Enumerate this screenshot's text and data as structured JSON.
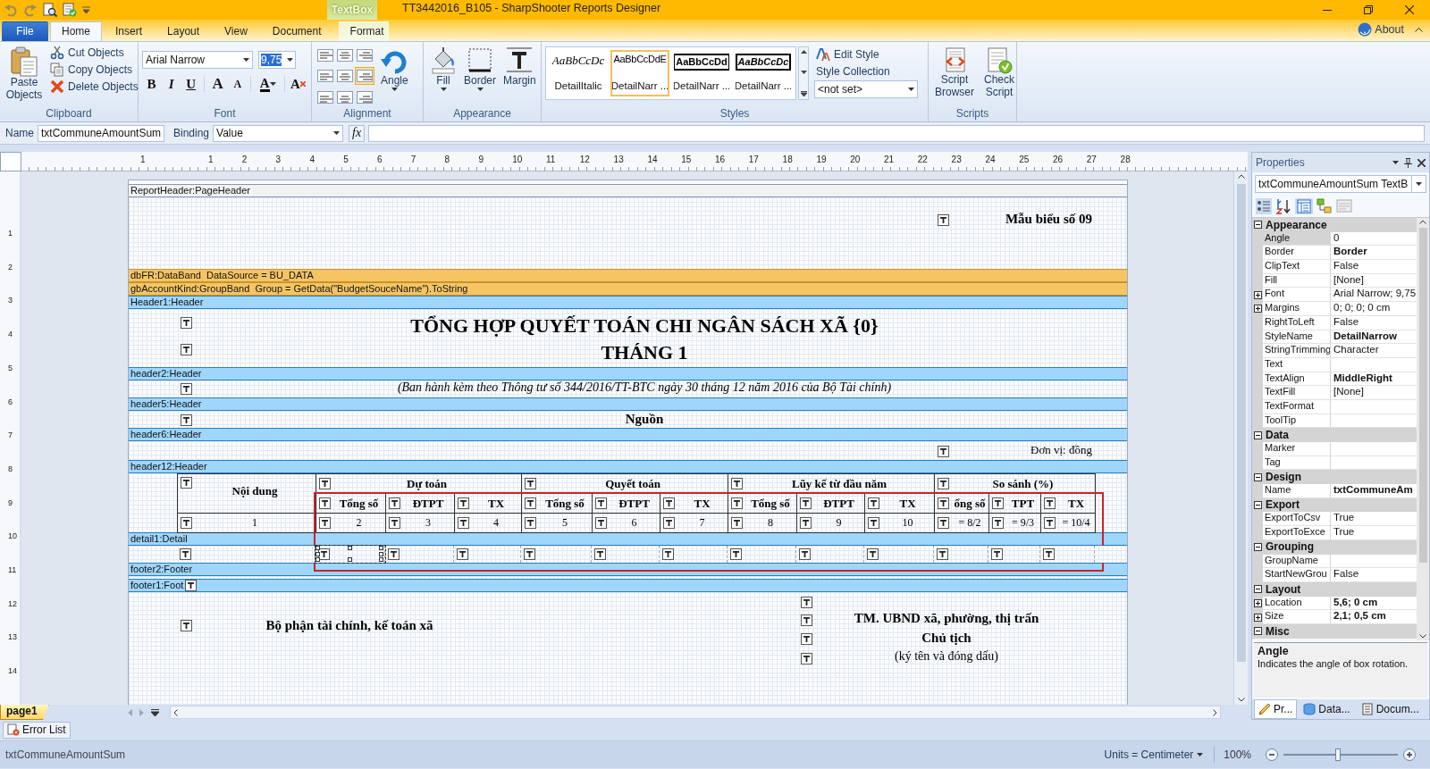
{
  "window": {
    "title": "TT3442016_B105 - SharpShooter Reports Designer",
    "context_tab": "TextBox"
  },
  "tabs": [
    {
      "label": "File",
      "kind": "file",
      "selected": false
    },
    {
      "label": "Home",
      "kind": "tab",
      "selected": true
    },
    {
      "label": "Insert",
      "kind": "tab",
      "selected": false
    },
    {
      "label": "Layout",
      "kind": "tab",
      "selected": false
    },
    {
      "label": "View",
      "kind": "tab",
      "selected": false
    },
    {
      "label": "Document",
      "kind": "tab",
      "selected": false
    },
    {
      "label": "Format",
      "kind": "context",
      "selected": false
    }
  ],
  "about": "About",
  "ribbon": {
    "clipboard": {
      "label": "Clipboard",
      "paste": "Paste Objects",
      "actions": [
        {
          "label": "Cut Objects",
          "kind": "cut"
        },
        {
          "label": "Copy Objects",
          "kind": "copy"
        },
        {
          "label": "Delete Objects",
          "kind": "delete"
        }
      ]
    },
    "font": {
      "label": "Font",
      "family": "Arial Narrow",
      "size": "9,75",
      "buttons": [
        {
          "label": "B",
          "kind": "bold"
        },
        {
          "label": "I",
          "kind": "italic"
        },
        {
          "label": "U",
          "kind": "underline"
        },
        {
          "label": "A",
          "kind": "grow"
        },
        {
          "label": "A",
          "kind": "shrink"
        },
        {
          "label": "A",
          "kind": "color"
        },
        {
          "label": "A",
          "kind": "clear"
        }
      ]
    },
    "alignment": {
      "label": "Alignment",
      "angle": "Angle",
      "buttons": [
        {
          "selected": false
        },
        {
          "selected": false
        },
        {
          "selected": false
        },
        {
          "selected": false
        },
        {
          "selected": false
        },
        {
          "selected": true
        },
        {
          "selected": false
        },
        {
          "selected": false
        },
        {
          "selected": false
        }
      ]
    },
    "appearance": {
      "label": "Appearance",
      "buttons": [
        {
          "label": "Fill",
          "kind": "fill"
        },
        {
          "label": "Border",
          "kind": "border"
        },
        {
          "label": "Margin",
          "kind": "margin"
        }
      ]
    },
    "styles": {
      "label": "Styles",
      "gallery": [
        {
          "preview": "AaBbCcDc",
          "name": "DetailItalic",
          "kind": "italic",
          "selected": false
        },
        {
          "preview": "AaBbCcDdE",
          "name": "DetailNarr ...",
          "kind": "narrow",
          "selected": true
        },
        {
          "preview": "AaBbCcDd",
          "name": "DetailNarr ...",
          "kind": "framed",
          "selected": false
        },
        {
          "preview": "AaBbCcDc",
          "name": "DetailNarr ...",
          "kind": "framed-italic",
          "selected": false
        }
      ],
      "edit_style": "Edit Style",
      "style_collection": "Style Collection",
      "collection_value": "<not set>"
    },
    "scripts": {
      "label": "Scripts",
      "buttons": [
        {
          "label": "Script Browser",
          "kind": "browser"
        },
        {
          "label": "Check Script",
          "kind": "check"
        }
      ]
    }
  },
  "name_bar": {
    "name_label": "Name",
    "name_value": "txtCommuneAmountSum",
    "binding_label": "Binding",
    "binding_value": "Value",
    "formula_button": "fx"
  },
  "designer": {
    "ruler": [
      "1",
      "1",
      "2",
      "3",
      "4",
      "5",
      "6",
      "7",
      "8",
      "9",
      "10",
      "11",
      "12",
      "13",
      "14",
      "15",
      "16",
      "17",
      "18",
      "19",
      "20",
      "21",
      "22",
      "23",
      "24",
      "25",
      "26",
      "27",
      "28"
    ],
    "vertical_ruler": [
      "1",
      "2",
      "3",
      "4",
      "5",
      "6",
      "7",
      "8",
      "9",
      "10",
      "11",
      "12",
      "13",
      "14"
    ],
    "bands": [
      {
        "title": "ReportHeader:PageHeader",
        "kind": "report",
        "texts": [
          "Mẫu biểu số 09"
        ]
      },
      {
        "title": "dbFR:DataBand  DataSource = BU_DATA",
        "kind": "data"
      },
      {
        "title": "gbAccountKind:GroupBand  Group = GetData(\"BudgetSouceName\").ToString",
        "kind": "data"
      },
      {
        "title": "Header1:Header",
        "kind": "section",
        "texts": [
          "TỔNG HỢP QUYẾT TOÁN CHI NGÂN SÁCH XÃ {0}",
          "THÁNG 1"
        ]
      },
      {
        "title": "header2:Header",
        "kind": "section",
        "texts": [
          "(Ban hành kèm theo Thông tư số 344/2016/TT-BTC ngày 30 tháng 12 năm 2016 của Bộ Tài chính)"
        ]
      },
      {
        "title": "header5:Header",
        "kind": "section",
        "texts": [
          "Nguồn"
        ]
      },
      {
        "title": "header6:Header",
        "kind": "section",
        "texts": [
          "Đơn vị: đồng"
        ]
      },
      {
        "title": "header12:Header",
        "kind": "section",
        "table": {
          "first_column": "Nội dung",
          "first_number": "1",
          "groups": [
            {
              "label": "Dự toán",
              "columns": [
                "Tổng số",
                "ĐTPT",
                "TX"
              ],
              "numbers": [
                "2",
                "3",
                "4"
              ]
            },
            {
              "label": "Quyết toán",
              "columns": [
                "Tổng số",
                "ĐTPT",
                "TX"
              ],
              "numbers": [
                "5",
                "6",
                "7"
              ]
            },
            {
              "label": "Lũy kế từ đầu năm",
              "columns": [
                "Tổng số",
                "ĐTPT",
                "TX"
              ],
              "numbers": [
                "8",
                "9",
                "10"
              ]
            },
            {
              "label": "So sánh (%)",
              "columns": [
                "ổng số",
                "TPT",
                "TX"
              ],
              "numbers": [
                "= 8/2",
                "= 9/3",
                "= 10/4"
              ]
            }
          ]
        }
      },
      {
        "title": "detail1:Detail",
        "kind": "section",
        "cells": [
          {
            "selected": false
          },
          {
            "selected": true
          },
          {
            "selected": false
          },
          {
            "selected": false
          },
          {
            "selected": false
          },
          {
            "selected": false
          },
          {
            "selected": false
          },
          {
            "selected": false
          },
          {
            "selected": false
          },
          {
            "selected": false
          },
          {
            "selected": false
          },
          {
            "selected": false
          },
          {
            "selected": false
          }
        ]
      },
      {
        "title": "footer2:Footer",
        "kind": "section"
      },
      {
        "title": "footer1:Foot",
        "kind": "section",
        "texts": [
          "Bộ phận tài chính, kế toán xã",
          "TM. UBND xã, phường, thị trấn",
          "Chủ tịch",
          "(ký tên và đóng dấu)"
        ]
      }
    ],
    "page_tab": "page1"
  },
  "properties": {
    "title": "Properties",
    "object": "txtCommuneAmountSum TextB",
    "categories": [
      {
        "name": "Appearance",
        "expanded": true,
        "rows": [
          {
            "name": "Angle",
            "value": "0",
            "bold": false,
            "expandable": false,
            "selected": true
          },
          {
            "name": "Border",
            "value": "Border",
            "bold": true,
            "expandable": false,
            "selected": false
          },
          {
            "name": "ClipText",
            "value": "False",
            "bold": false,
            "expandable": false,
            "selected": false
          },
          {
            "name": "Fill",
            "value": "[None]",
            "bold": false,
            "expandable": false,
            "selected": false
          },
          {
            "name": "Font",
            "value": "Arial Narrow; 9,75",
            "bold": false,
            "expandable": true,
            "selected": false
          },
          {
            "name": "Margins",
            "value": "0; 0; 0; 0 cm",
            "bold": false,
            "expandable": true,
            "selected": false
          },
          {
            "name": "RightToLeft",
            "value": "False",
            "bold": false,
            "expandable": false,
            "selected": false
          },
          {
            "name": "StyleName",
            "value": "DetailNarrow",
            "bold": true,
            "expandable": false,
            "selected": false
          },
          {
            "name": "StringTrimming",
            "value": "Character",
            "bold": false,
            "expandable": false,
            "selected": false
          },
          {
            "name": "Text",
            "bold": false,
            "expandable": false,
            "selected": false
          },
          {
            "name": "TextAlign",
            "value": "MiddleRight",
            "bold": true,
            "expandable": false,
            "selected": false
          },
          {
            "name": "TextFill",
            "value": "[None]",
            "bold": false,
            "expandable": false,
            "selected": false
          },
          {
            "name": "TextFormat",
            "bold": false,
            "expandable": false,
            "selected": false
          },
          {
            "name": "ToolTip",
            "bold": false,
            "expandable": false,
            "selected": false
          }
        ]
      },
      {
        "name": "Data",
        "expanded": true,
        "rows": [
          {
            "name": "Marker",
            "bold": false,
            "expandable": false,
            "selected": false
          },
          {
            "name": "Tag",
            "bold": false,
            "expandable": false,
            "selected": false
          }
        ]
      },
      {
        "name": "Design",
        "expanded": true,
        "rows": [
          {
            "name": "Name",
            "value": "txtCommuneAm",
            "bold": true,
            "expandable": false,
            "selected": false
          }
        ]
      },
      {
        "name": "Export",
        "expanded": true,
        "rows": [
          {
            "name": "ExportToCsv",
            "value": "True",
            "bold": false,
            "expandable": false,
            "selected": false
          },
          {
            "name": "ExportToExce",
            "value": "True",
            "bold": false,
            "expandable": false,
            "selected": false
          }
        ]
      },
      {
        "name": "Grouping",
        "expanded": true,
        "rows": [
          {
            "name": "GroupName",
            "bold": false,
            "expandable": false,
            "selected": false
          },
          {
            "name": "StartNewGrou",
            "value": "False",
            "bold": false,
            "expandable": false,
            "selected": false
          }
        ]
      },
      {
        "name": "Layout",
        "expanded": true,
        "rows": [
          {
            "name": "Location",
            "value": "5,6; 0 cm",
            "bold": true,
            "expandable": true,
            "selected": false
          },
          {
            "name": "Size",
            "value": "2,1; 0,5 cm",
            "bold": true,
            "expandable": true,
            "selected": false
          }
        ]
      },
      {
        "name": "Misc",
        "expanded": true
      }
    ],
    "help_title": "Angle",
    "help_text": "Indicates the angle of box rotation.",
    "tabs": [
      {
        "label": "Pr...",
        "kind": "properties",
        "selected": true
      },
      {
        "label": "Data...",
        "kind": "data",
        "selected": false
      },
      {
        "label": "Docum...",
        "kind": "document",
        "selected": false
      }
    ]
  },
  "error_list": "Error List",
  "status_bar": {
    "object": "txtCommuneAmountSum",
    "units": "Units = Centimeter",
    "zoom": "100%",
    "zoom_slider": {
      "level": 0.48
    }
  }
}
